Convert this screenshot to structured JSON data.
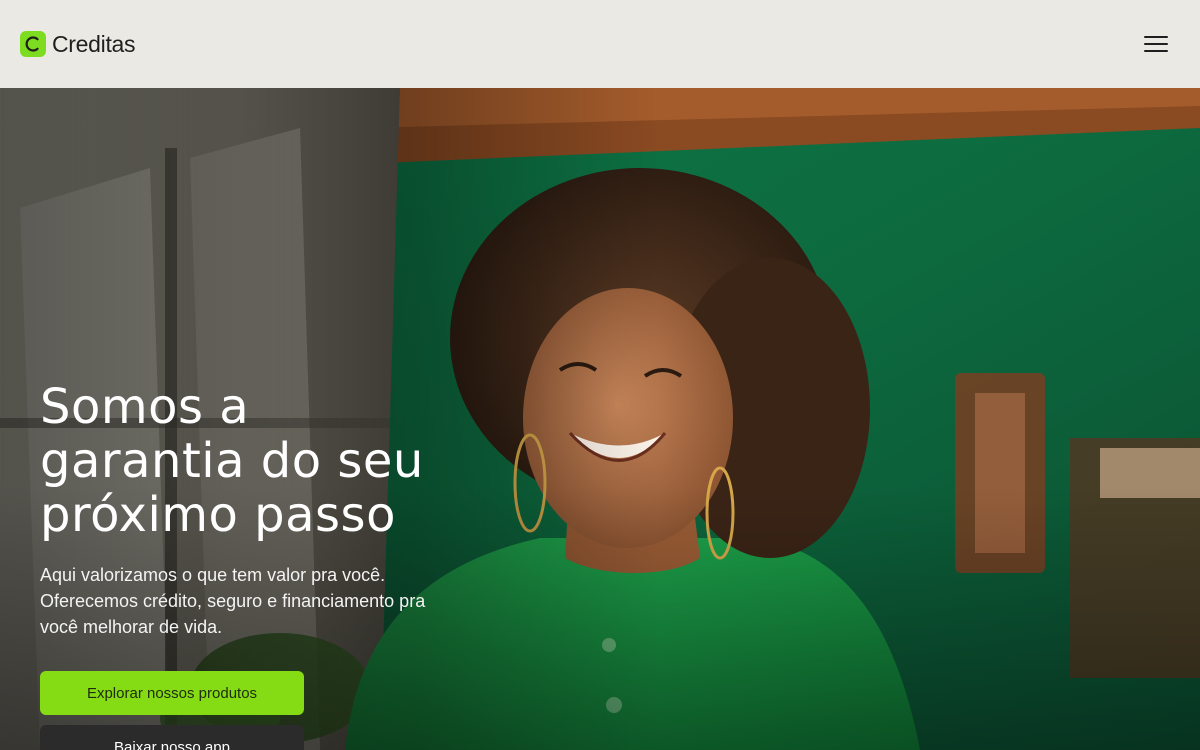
{
  "header": {
    "brand": "Creditas",
    "menu_icon": "hamburger-menu-icon",
    "logo_icon": "creditas-c-logo-icon"
  },
  "hero": {
    "title_lines": [
      "Somos a",
      "garantia do seu",
      "próximo passo"
    ],
    "subtitle": "Aqui valorizamos o que tem valor pra você. Oferecemos crédito, seguro e financiamento pra você melhorar de vida.",
    "primary_cta": "Explorar nossos produtos",
    "secondary_cta": "Baixar nosso app",
    "image": "smiling-woman-green-shirt-photo"
  },
  "colors": {
    "header_bg": "#ebe9e3",
    "brand_green": "#86dc14",
    "dark_button": "#2b2b2b",
    "wall_green": "#0f6b40"
  }
}
